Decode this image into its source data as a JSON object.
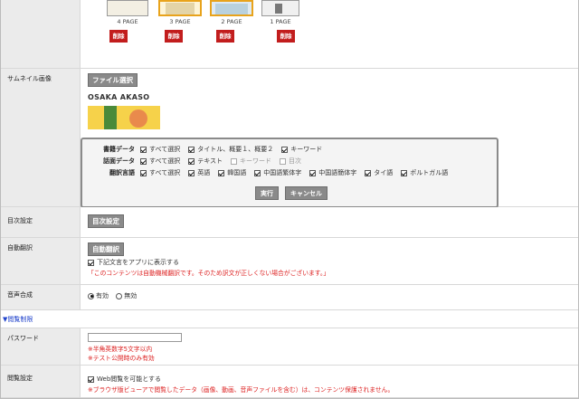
{
  "pages": [
    {
      "label": "4 PAGE",
      "delete": "削除",
      "selected": false
    },
    {
      "label": "3 PAGE",
      "delete": "削除",
      "selected": true
    },
    {
      "label": "2 PAGE",
      "delete": "削除",
      "selected": true
    },
    {
      "label": "1 PAGE",
      "delete": "削除",
      "selected": false
    }
  ],
  "thumbnail": {
    "label": "サムネイル画像",
    "file_button": "ファイル選択",
    "cover_title": "OSAKA AKASO"
  },
  "popup": {
    "rows": [
      {
        "label": "書籍データ",
        "options": [
          {
            "text": "すべて選択",
            "checked": true
          },
          {
            "text": "タイトル、概要１、概要２",
            "checked": true
          },
          {
            "text": "キーワード",
            "checked": true
          }
        ]
      },
      {
        "label": "話面データ",
        "options": [
          {
            "text": "すべて選択",
            "checked": true
          },
          {
            "text": "テキスト",
            "checked": true
          },
          {
            "text": "キーワード",
            "checked": false,
            "disabled": true
          },
          {
            "text": "目次",
            "checked": false,
            "disabled": true
          }
        ]
      },
      {
        "label": "翻訳言語",
        "options": [
          {
            "text": "すべて選択",
            "checked": true
          },
          {
            "text": "英語",
            "checked": true
          },
          {
            "text": "韓国語",
            "checked": true
          },
          {
            "text": "中国語繁体字",
            "checked": true
          },
          {
            "text": "中国語簡体字",
            "checked": true
          },
          {
            "text": "タイ語",
            "checked": true
          },
          {
            "text": "ポルトガル語",
            "checked": true
          }
        ]
      }
    ],
    "run_button": "実行",
    "cancel_button": "キャンセル"
  },
  "toc": {
    "label": "目次設定",
    "button": "目次設定"
  },
  "autotrans": {
    "label": "自動翻訳",
    "button": "自動翻訳",
    "checkbox_text": "下記文言をアプリに表示する",
    "checked": true,
    "notice": "「このコンテンツは自動機械翻訳です。そのため訳文が正しくない場合がございます。」"
  },
  "voice": {
    "label": "音声合成",
    "options": [
      {
        "text": "有効",
        "selected": true
      },
      {
        "text": "無効",
        "selected": false
      }
    ]
  },
  "section_link": "▼閲覧制限",
  "password": {
    "label": "パスワード",
    "value": "",
    "note1": "※半角英数字5文字以内",
    "note2": "※テスト公開時のみ有効"
  },
  "browse": {
    "label": "閲覧設定",
    "checkbox_text": "Web閲覧を可能とする",
    "checked": true,
    "note": "※ブラウザ版ビューアで閲覧したデータ（画像、動画、音声ファイルを含む）は、コンテンツ保護されません。"
  },
  "colors": {
    "accent_red": "#c21d1d",
    "gray_button": "#8a8a8a",
    "label_bg": "#ebebeb",
    "selected_border": "#e8a31c"
  }
}
